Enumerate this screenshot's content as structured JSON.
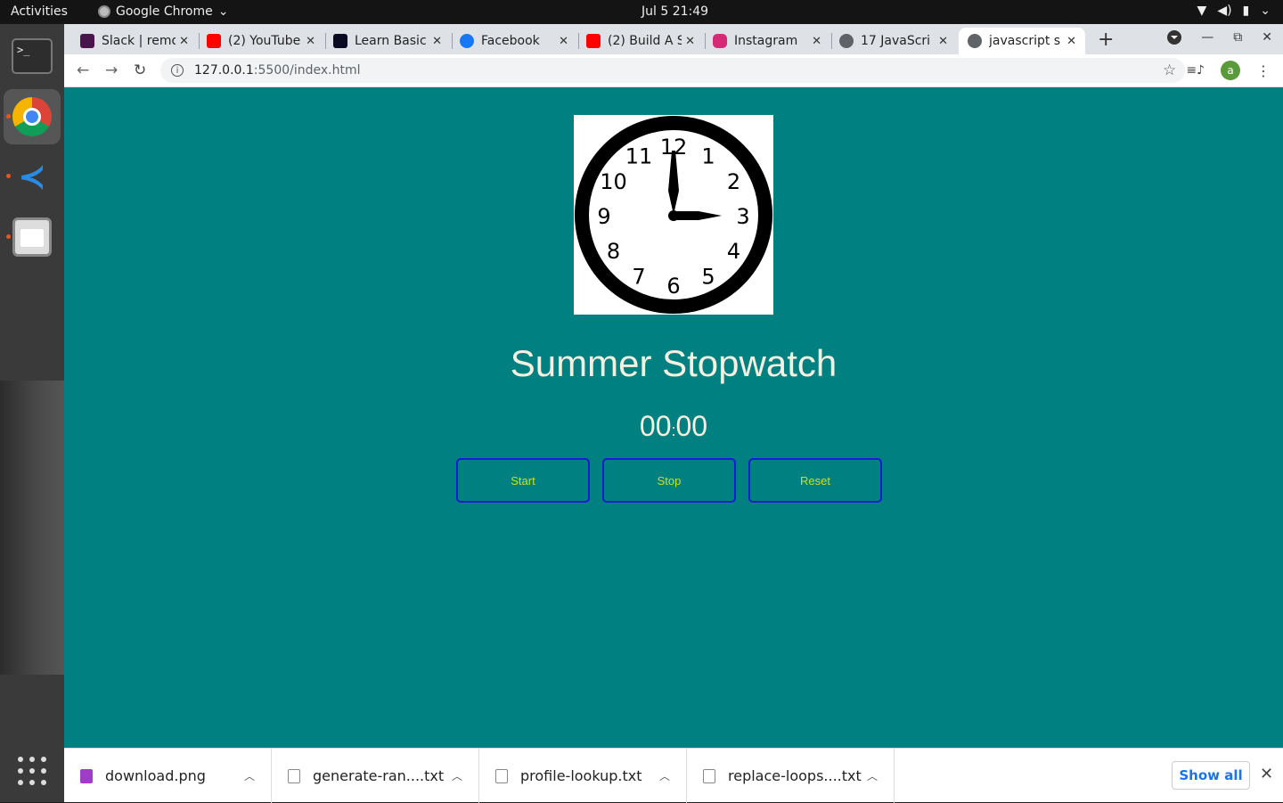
{
  "topbar": {
    "activities": "Activities",
    "app_name": "Google Chrome",
    "clock": "Jul 5  21:49"
  },
  "tabs": [
    {
      "title": "Slack | remo",
      "color": "#4a154b"
    },
    {
      "title": "(2) YouTube",
      "color": "#ff0000"
    },
    {
      "title": "Learn Basic",
      "color": "#0a0a23"
    },
    {
      "title": "Facebook",
      "color": "#1877f2"
    },
    {
      "title": "(2) Build A S",
      "color": "#ff0000"
    },
    {
      "title": "Instagram",
      "color": "#d62976"
    },
    {
      "title": "17 JavaScri",
      "color": "#5f6368"
    },
    {
      "title": "javascript s",
      "color": "#5f6368"
    }
  ],
  "omnibox": {
    "host": "127.0.0.1",
    "path": ":5500/index.html"
  },
  "profile_initial": "a",
  "page": {
    "title": "Summer Stopwatch",
    "timer_minutes": "00",
    "timer_colon": ":",
    "timer_seconds": "00",
    "buttons": {
      "start": "Start",
      "stop": "Stop",
      "reset": "Reset"
    },
    "clock_numbers": [
      "12",
      "1",
      "2",
      "3",
      "4",
      "5",
      "6",
      "7",
      "8",
      "9",
      "10",
      "11"
    ]
  },
  "downloads": [
    {
      "name": "download.png",
      "type": "image"
    },
    {
      "name": "generate-ran....txt",
      "type": "text"
    },
    {
      "name": "profile-lookup.txt",
      "type": "text"
    },
    {
      "name": "replace-loops....txt",
      "type": "text"
    }
  ],
  "downloads_show_all": "Show all",
  "colors": {
    "page_bg": "#008080",
    "title_color": "#f5f0e0",
    "button_border": "#1a1adb",
    "button_text": "#c8e020"
  }
}
